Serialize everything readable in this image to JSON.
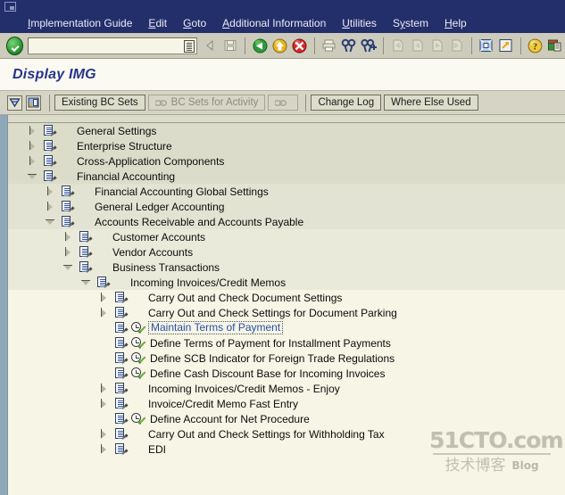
{
  "window": {
    "system_icon": "sap-system-menu-icon"
  },
  "menubar": {
    "items": [
      {
        "label": "Implementation Guide",
        "accel": "I"
      },
      {
        "label": "Edit",
        "accel": "E"
      },
      {
        "label": "Goto",
        "accel": "G"
      },
      {
        "label": "Additional Information",
        "accel": "A"
      },
      {
        "label": "Utilities",
        "accel": "U"
      },
      {
        "label": "System",
        "accel": "y"
      },
      {
        "label": "Help",
        "accel": "H"
      }
    ]
  },
  "toolbar": {
    "enter_button": "enter-green-check",
    "command_field": {
      "value": "",
      "placeholder": ""
    },
    "icons": [
      "back-arrow-small-icon",
      "save-icon",
      "back-green-icon",
      "exit-yellow-icon",
      "cancel-red-icon",
      "print-icon",
      "find-icon",
      "find-next-icon",
      "first-page-icon",
      "previous-page-icon",
      "next-page-icon",
      "last-page-icon",
      "create-session-icon",
      "create-shortcut-icon",
      "help-icon",
      "customize-layout-icon"
    ]
  },
  "heading": {
    "title": "Display IMG"
  },
  "apptoolbar": {
    "collapse_icon": "collapse-tree-icon",
    "select_icon": "select-subtree-icon",
    "buttons": [
      {
        "label": "Existing BC Sets",
        "disabled": false,
        "icon": null
      },
      {
        "label": "BC Sets for Activity",
        "disabled": true,
        "icon": "bc-set-link-icon"
      },
      {
        "label": "",
        "disabled": true,
        "icon": "bc-set-link-icon-2"
      },
      {
        "label": "Change Log",
        "disabled": false,
        "icon": null
      },
      {
        "label": "Where Else Used",
        "disabled": false,
        "icon": null
      }
    ]
  },
  "tree": {
    "rows": [
      {
        "label": "General Settings",
        "indent": 0,
        "twisty": "closed",
        "icon": "img-node-icon",
        "band": "a",
        "link": false
      },
      {
        "label": "Enterprise Structure",
        "indent": 0,
        "twisty": "closed",
        "icon": "img-node-icon",
        "band": "a",
        "link": false
      },
      {
        "label": "Cross-Application Components",
        "indent": 0,
        "twisty": "closed",
        "icon": "img-node-icon",
        "band": "a",
        "link": false
      },
      {
        "label": "Financial Accounting",
        "indent": 0,
        "twisty": "open",
        "icon": "img-node-icon",
        "band": "a",
        "link": false
      },
      {
        "label": "Financial Accounting Global Settings",
        "indent": 1,
        "twisty": "closed",
        "icon": "img-node-icon",
        "band": "b",
        "link": false
      },
      {
        "label": "General Ledger Accounting",
        "indent": 1,
        "twisty": "closed",
        "icon": "img-node-icon",
        "band": "b",
        "link": false
      },
      {
        "label": "Accounts Receivable and Accounts Payable",
        "indent": 1,
        "twisty": "open",
        "icon": "img-node-icon",
        "band": "b",
        "link": false
      },
      {
        "label": "Customer Accounts",
        "indent": 2,
        "twisty": "closed",
        "icon": "img-node-icon",
        "band": "c",
        "link": false
      },
      {
        "label": "Vendor Accounts",
        "indent": 2,
        "twisty": "closed",
        "icon": "img-node-icon",
        "band": "c",
        "link": false
      },
      {
        "label": "Business Transactions",
        "indent": 2,
        "twisty": "open",
        "icon": "img-node-icon",
        "band": "c",
        "link": false
      },
      {
        "label": "Incoming Invoices/Credit Memos",
        "indent": 3,
        "twisty": "open",
        "icon": "img-node-icon",
        "band": "d",
        "link": false
      },
      {
        "label": "Carry Out and Check Document Settings",
        "indent": 4,
        "twisty": "closed",
        "icon": "img-node-icon",
        "band": "e",
        "link": false
      },
      {
        "label": "Carry Out and Check Settings for Document Parking",
        "indent": 4,
        "twisty": "closed",
        "icon": "img-node-icon",
        "band": "e",
        "link": false
      },
      {
        "label": "Maintain Terms of Payment",
        "indent": 4,
        "twisty": "none",
        "icon": "img-activity-icon",
        "band": "e",
        "link": true
      },
      {
        "label": "Define Terms of Payment for Installment Payments",
        "indent": 4,
        "twisty": "none",
        "icon": "img-activity-icon",
        "band": "e",
        "link": false
      },
      {
        "label": "Define SCB Indicator for Foreign Trade Regulations",
        "indent": 4,
        "twisty": "none",
        "icon": "img-activity-icon",
        "band": "e",
        "link": false
      },
      {
        "label": "Define Cash Discount Base for Incoming Invoices",
        "indent": 4,
        "twisty": "none",
        "icon": "img-activity-icon",
        "band": "e",
        "link": false
      },
      {
        "label": "Incoming Invoices/Credit Memos - Enjoy",
        "indent": 4,
        "twisty": "closed",
        "icon": "img-node-icon",
        "band": "e",
        "link": false
      },
      {
        "label": "Invoice/Credit Memo Fast Entry",
        "indent": 4,
        "twisty": "closed",
        "icon": "img-node-icon",
        "band": "e",
        "link": false
      },
      {
        "label": "Define Account for Net Procedure",
        "indent": 4,
        "twisty": "none",
        "icon": "img-activity-icon",
        "band": "e",
        "link": false
      },
      {
        "label": "Carry Out and Check Settings for Withholding Tax",
        "indent": 4,
        "twisty": "closed",
        "icon": "img-node-icon",
        "band": "e",
        "link": false
      },
      {
        "label": "EDI",
        "indent": 4,
        "twisty": "closed",
        "icon": "img-node-icon",
        "band": "e",
        "link": false
      }
    ]
  },
  "watermark": {
    "line1": "51CTO.com",
    "line2": "技术博客",
    "line3": "Blog"
  },
  "colors": {
    "menu_bg": "#232f6b",
    "toolbar_bg": "#cccbbc",
    "heading_text": "#27348b",
    "tree_bg": "#f6f5e6",
    "link": "#2a4fa8"
  }
}
